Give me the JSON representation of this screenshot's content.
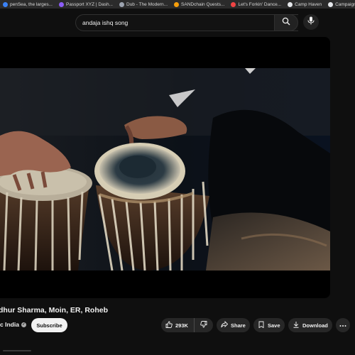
{
  "bookmarks": [
    {
      "label": "penSea, the larges...",
      "color": "#3b82f6"
    },
    {
      "label": "Passport XYZ | Dash...",
      "color": "#8b5cf6"
    },
    {
      "label": "Dub - The Modern...",
      "color": "#9ca3af"
    },
    {
      "label": "SANDchain Quests...",
      "color": "#f59e0b"
    },
    {
      "label": "Let's Forkin' Dance...",
      "color": "#ef4444"
    },
    {
      "label": "Camp Haven",
      "color": "#e5e7eb"
    },
    {
      "label": "Campaign",
      "color": "#e5e7eb"
    }
  ],
  "search": {
    "query": "andaja ishq song",
    "clear_icon": "close-icon",
    "search_icon": "search-icon",
    "mic_icon": "mic-icon"
  },
  "video": {
    "title": "dhur Sharma, Moin, ER, Roheb"
  },
  "channel": {
    "name": "c India",
    "subscribe_label": "Subscribe"
  },
  "actions": {
    "like_count": "293K",
    "share_label": "Share",
    "save_label": "Save",
    "download_label": "Download"
  },
  "colors": {
    "background": "#0f0f0f",
    "pill": "#272727",
    "subscribe_bg": "#f1f1f1"
  }
}
